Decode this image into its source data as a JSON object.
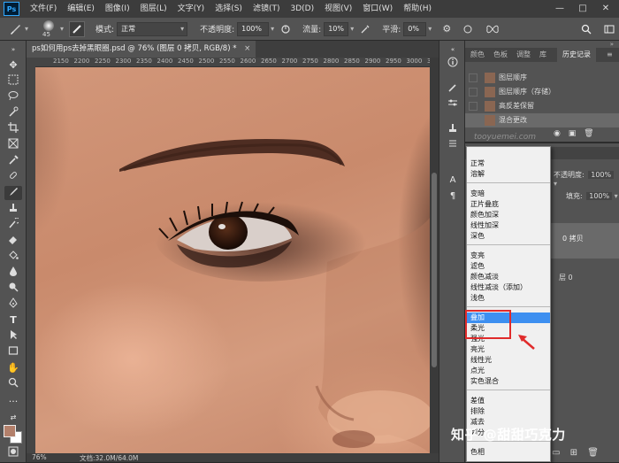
{
  "menubar": {
    "logo": "Ps",
    "items": [
      "文件(F)",
      "编辑(E)",
      "图像(I)",
      "图层(L)",
      "文字(Y)",
      "选择(S)",
      "滤镜(T)",
      "3D(D)",
      "视图(V)",
      "窗口(W)",
      "帮助(H)"
    ],
    "window_controls": [
      "—",
      "□",
      "✕"
    ]
  },
  "options": {
    "brush_size": "45",
    "mode_label": "模式:",
    "mode_value": "正常",
    "opacity_label": "不透明度:",
    "opacity_value": "100%",
    "flow_label": "流量:",
    "flow_value": "10%",
    "smooth_label": "平滑:",
    "smooth_value": "0%"
  },
  "document": {
    "tab_title": "ps如何用ps去掉黑眼圈.psd @ 76% (图层 0 拷贝, RGB/8) *",
    "tab_close": "×",
    "zoom": "76%",
    "doc_info": "文档:32.0M/64.0M"
  },
  "ruler": {
    "labels": [
      "2150",
      "2200",
      "2250",
      "2300",
      "2350",
      "2400",
      "2450",
      "2500",
      "2550",
      "2600",
      "2650",
      "2700",
      "2750",
      "2800",
      "2850",
      "2900",
      "2950",
      "3000",
      "3050"
    ]
  },
  "panels": {
    "top_tabs": [
      "颜色",
      "色板",
      "调整",
      "库",
      "历史记录"
    ],
    "history": [
      "图层顺序",
      "图层顺序（存储）",
      "高反差保留",
      "混合更改"
    ],
    "layers_tabs": [
      "图层",
      "通道",
      "路径"
    ],
    "opacity_label": "不透明度:",
    "opacity_value": "100%",
    "fill_label": "填充:",
    "fill_value": "100%",
    "layer_names": [
      "0 拷贝",
      "层 0"
    ],
    "site_watermark": "tooyuemei.com"
  },
  "blend_modes": {
    "groups": [
      [
        "正常",
        "溶解"
      ],
      [
        "变暗",
        "正片叠底",
        "颜色加深",
        "线性加深",
        "深色"
      ],
      [
        "变亮",
        "滤色",
        "颜色减淡",
        "线性减淡（添加）",
        "浅色"
      ],
      [
        "叠加",
        "柔光",
        "强光",
        "亮光",
        "线性光",
        "点光",
        "实色混合"
      ],
      [
        "差值",
        "排除",
        "减去",
        "划分"
      ],
      [
        "色相"
      ]
    ],
    "selected": "叠加"
  },
  "watermark": "知乎 @甜甜巧克力",
  "colors": {
    "selection": "#3d8ff0",
    "annotation": "#e02b2b",
    "foreground_swatch": "#b3806b",
    "background_swatch": "#ffffff"
  }
}
